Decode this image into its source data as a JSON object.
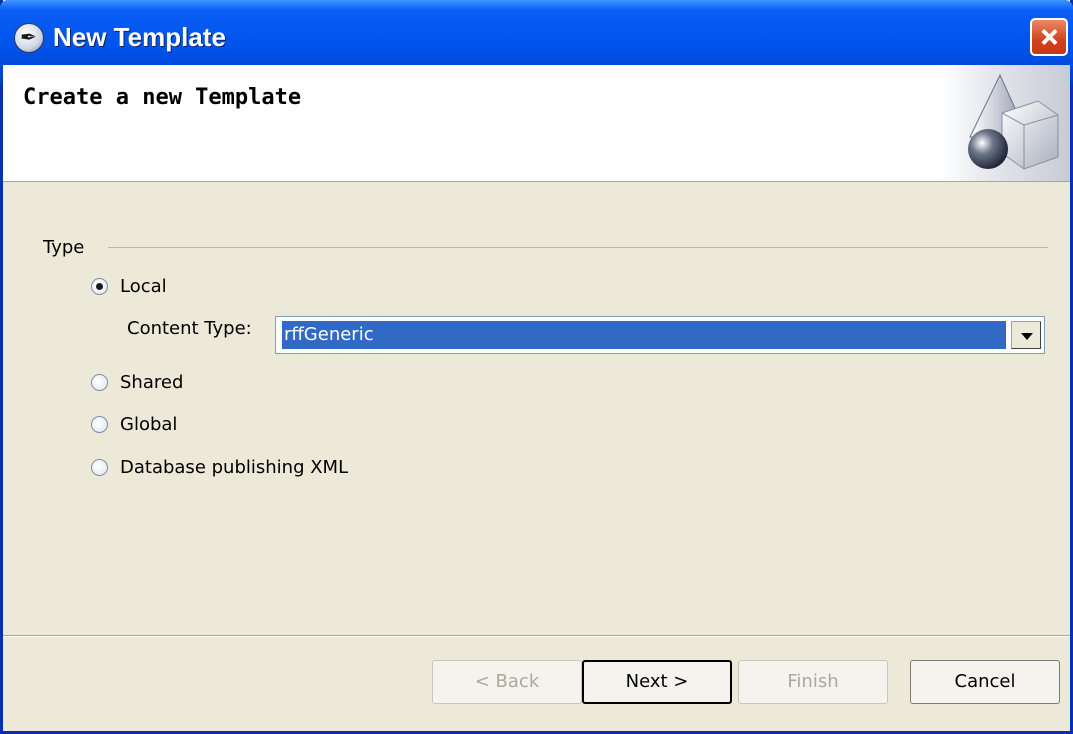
{
  "window": {
    "title": "New Template",
    "icon": "template-app-icon"
  },
  "banner": {
    "heading": "Create a new Template",
    "art": "3d-shapes-graphic"
  },
  "type_group": {
    "label": "Type",
    "options": [
      {
        "label": "Local",
        "checked": true
      },
      {
        "label": "Shared",
        "checked": false
      },
      {
        "label": "Global",
        "checked": false
      },
      {
        "label": "Database publishing XML",
        "checked": false
      }
    ],
    "content_type": {
      "label": "Content Type:",
      "value": "rffGeneric"
    }
  },
  "buttons": {
    "back": {
      "label": "< Back",
      "enabled": false
    },
    "next": {
      "label": "Next >",
      "enabled": true,
      "default": true
    },
    "finish": {
      "label": "Finish",
      "enabled": false
    },
    "cancel": {
      "label": "Cancel",
      "enabled": true
    }
  },
  "colors": {
    "titlebar": "#0053ea",
    "dialog_bg": "#ece9d8",
    "selection": "#316ac5"
  }
}
